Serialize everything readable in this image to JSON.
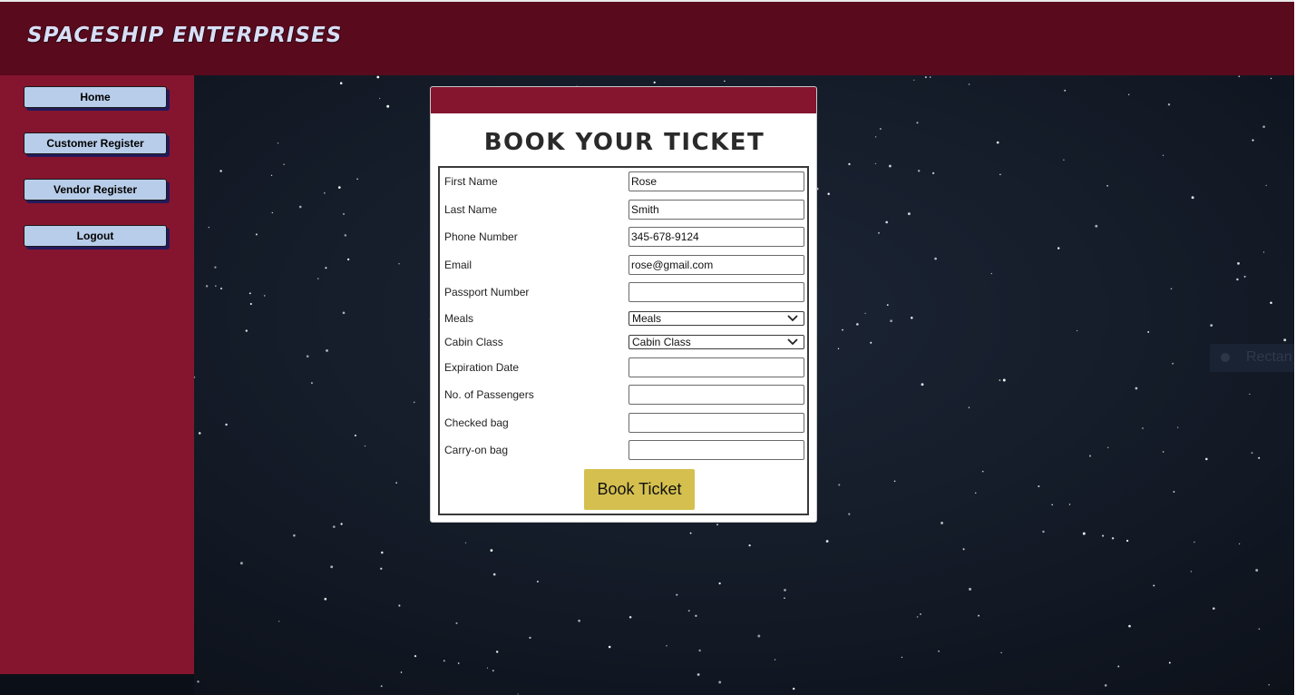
{
  "brand": {
    "title": "Spaceship Enterprises"
  },
  "sidebar": {
    "items": [
      {
        "label": "Home"
      },
      {
        "label": "Customer Register"
      },
      {
        "label": "Vendor Register"
      },
      {
        "label": "Logout"
      }
    ]
  },
  "form": {
    "title": "Book Your Ticket",
    "fields": {
      "first_name": {
        "label": "First Name",
        "value": "Rose"
      },
      "last_name": {
        "label": "Last Name",
        "value": "Smith"
      },
      "phone": {
        "label": "Phone Number",
        "value": "345-678-9124"
      },
      "email": {
        "label": "Email",
        "value": "rose@gmail.com"
      },
      "passport": {
        "label": "Passport Number",
        "value": ""
      },
      "meals": {
        "label": "Meals",
        "selected": "Meals"
      },
      "cabin_class": {
        "label": "Cabin Class",
        "selected": "Cabin Class"
      },
      "expiration": {
        "label": "Expiration Date",
        "value": ""
      },
      "passengers": {
        "label": "No. of Passengers",
        "value": ""
      },
      "checked_bag": {
        "label": "Checked bag",
        "value": ""
      },
      "carry_on": {
        "label": "Carry-on bag",
        "value": ""
      }
    },
    "submit_label": "Book Ticket"
  },
  "overlay": {
    "label": "Rectan"
  },
  "icons": {
    "select_arrow": "chevron-down-icon"
  },
  "colors": {
    "header_bg": "#5a0a1d",
    "sidebar_bg": "#85152e",
    "nav_button_bg": "#b8cde9",
    "submit_button_bg": "#d5c04f",
    "space_bg": "#131a26"
  }
}
